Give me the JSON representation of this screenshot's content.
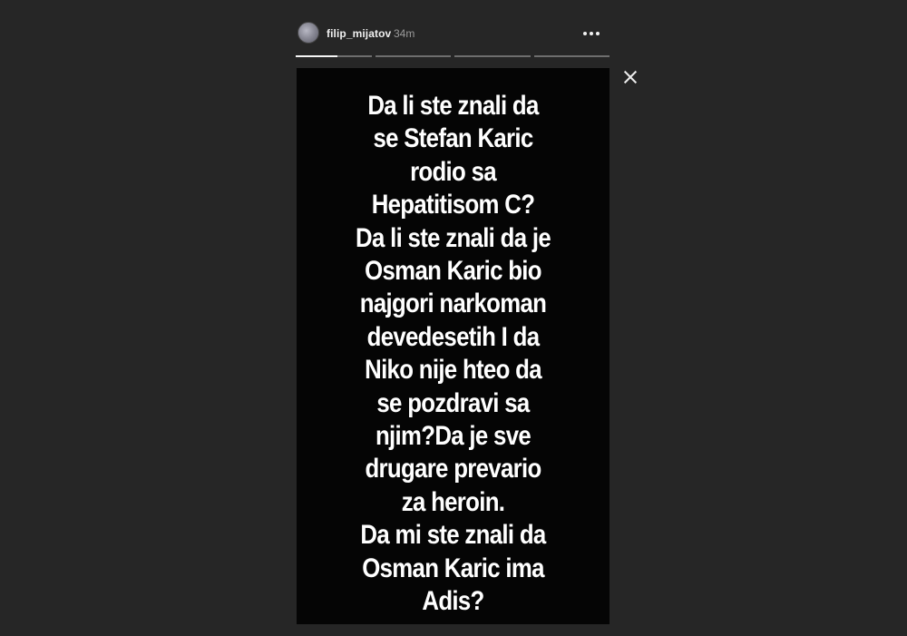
{
  "story_header": {
    "username": "filip_mijatov",
    "timestamp": "34m",
    "avatar_icon": "user-avatar",
    "more_icon": "more-horizontal-icon"
  },
  "progress_bars": [
    {
      "state": "current",
      "fill_fraction": 0.55
    },
    {
      "state": "upcoming",
      "fill_fraction": 0
    },
    {
      "state": "upcoming",
      "fill_fraction": 0
    },
    {
      "state": "upcoming",
      "fill_fraction": 0
    }
  ],
  "close_icon": "close-icon",
  "story": {
    "background_color": "#050505",
    "text_color": "#ffffff",
    "lines": [
      "Da li ste znali da",
      "se Stefan Karic",
      "rodio sa",
      "Hepatitisom C?",
      "Da li ste znali da je",
      "Osman Karic bio",
      "najgori narkoman",
      "devedesetih I da",
      "Niko nije hteo da",
      "se pozdravi sa",
      "njim?Da je sve",
      "drugare prevario",
      "za heroin.",
      "Da mi ste znali da",
      "Osman Karic ima",
      "Adis?"
    ]
  },
  "colors": {
    "page_background": "#262626",
    "progress_active": "#f5f5f5",
    "progress_inactive": "#6e6e6e"
  }
}
